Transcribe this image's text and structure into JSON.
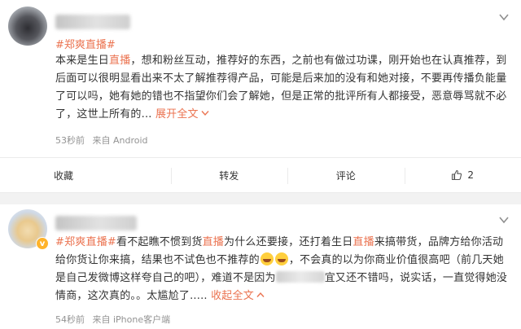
{
  "post1": {
    "topic": "#郑爽直播#",
    "text_a": "本来是生日",
    "hl_a": "直播",
    "text_b": "，想和粉丝互动，推荐好的东西，之前也有做过功课，刚开始也在认真推荐，到后面可以很明显看出来不太了解推荐得产品，可能是后来加的没有和她对接，不要再传播负能量了可以吗，她有她的错也不指望你们会了解她，但是正常的批评所有人都接受，恶意辱骂就不必了，这世上所有的",
    "expand": "展开全文",
    "time": "53秒前",
    "source": "来自 Android"
  },
  "actions": {
    "collect": "收藏",
    "repost": "转发",
    "comment": "评论",
    "likes": "2"
  },
  "post2": {
    "topic": "#郑爽直播#",
    "t1": "看不起瞧不惯到货",
    "h1": "直播",
    "t2": "为什么还要接，还打着生日",
    "h2": "直播",
    "t3": "来搞带货，品牌方给你活动给你货让你来搞，结果也不试色也不推荐的",
    "t4": "，不会真的以为你商业价值很高吧（前几天她是自己发微博这样夸自己的吧），难道不是因为",
    "t5": "宜又还不错吗，说实话，一直觉得她没情商，这次真的。。太尴尬了.....",
    "expand": "收起全文",
    "time": "54秒前",
    "source": "来自 iPhone客户端"
  },
  "colors": {
    "accent": "#eb7350",
    "meta": "#939393",
    "badge": "#ffb32a"
  }
}
